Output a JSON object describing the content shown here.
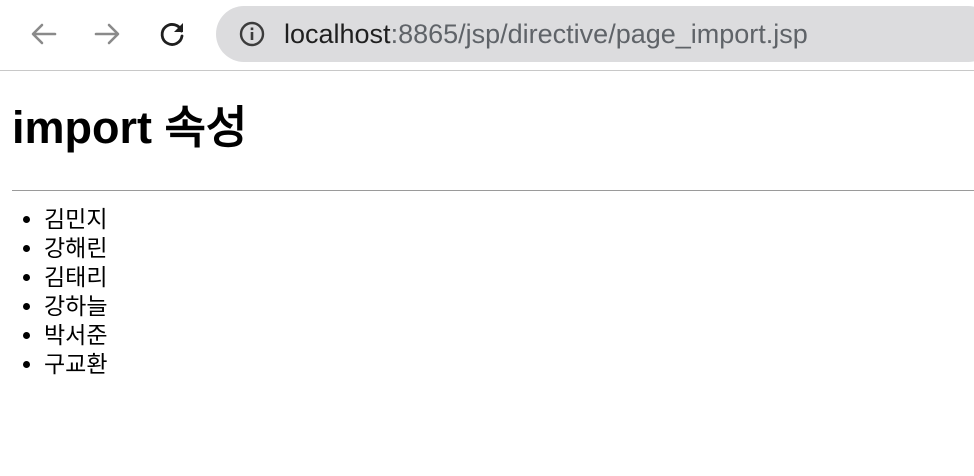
{
  "browser": {
    "url_host": "localhost",
    "url_path": ":8865/jsp/directive/page_import.jsp",
    "icons": {
      "back": "back-arrow-icon",
      "forward": "forward-arrow-icon",
      "reload": "reload-icon",
      "site_info": "info-icon"
    }
  },
  "page": {
    "title": "import 속성",
    "names": [
      "김민지",
      "강해린",
      "김태리",
      "강하늘",
      "박서준",
      "구교환"
    ]
  }
}
